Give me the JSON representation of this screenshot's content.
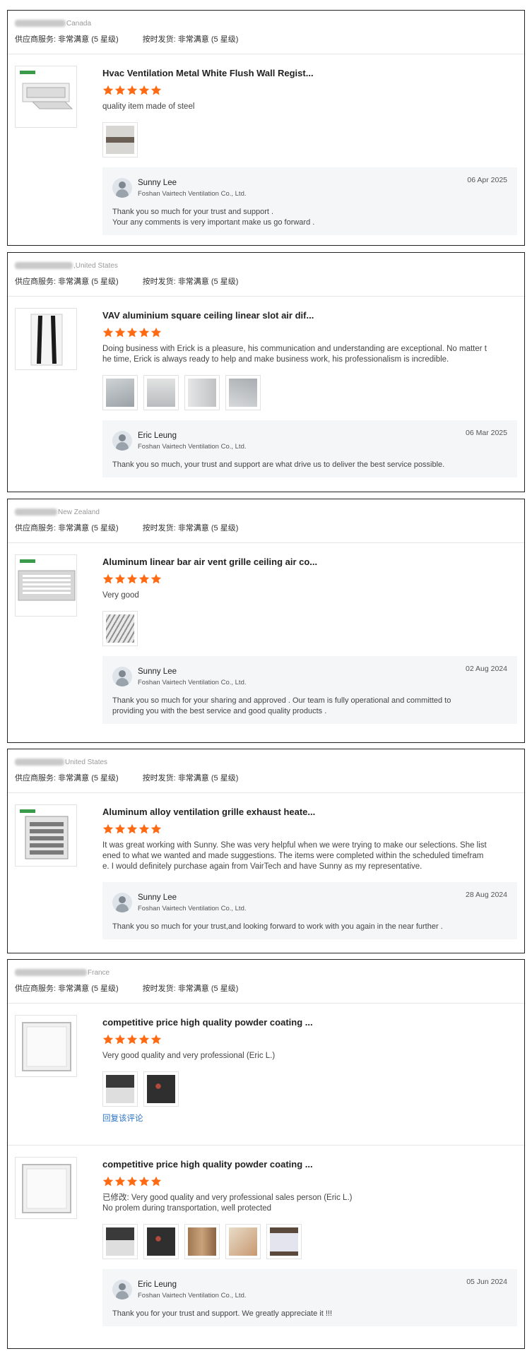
{
  "star_color": "#ff6a13",
  "rating_labels": {
    "supplier_service": "供应商服务:",
    "on_time": "按时发货:",
    "value": "非常满意",
    "level": "(5 星级)"
  },
  "reviews": [
    {
      "country": "Canada",
      "products": [
        {
          "title": "Hvac Ventilation Metal White Flush Wall Regist...",
          "stars": 5,
          "text": "quality item made of steel",
          "photo_count": 1
        }
      ],
      "reply": {
        "name": "Sunny Lee",
        "company": "Foshan Vairtech Ventilation Co., Ltd.",
        "date": "06 Apr 2025",
        "text_line1": "Thank you so much for your trust and support .",
        "text_line2": "Your any comments is very important make us go forward ."
      }
    },
    {
      "country": ",United States",
      "products": [
        {
          "title": "VAV aluminium square ceiling linear slot air dif...",
          "stars": 5,
          "text_line1": "Doing business with Erick is a pleasure, his communication and understanding are exceptional. No matter t",
          "text_line2": "he time, Erick is always ready to help and make business work, his professionalism is incredible.",
          "photo_count": 4
        }
      ],
      "reply": {
        "name": "Eric Leung",
        "company": "Foshan Vairtech Ventilation Co., Ltd.",
        "date": "06 Mar 2025",
        "text_line1": "Thank you so much, your trust and support are what drive us to deliver the best service possible."
      }
    },
    {
      "country": "New Zealand",
      "products": [
        {
          "title": "Aluminum linear bar air vent grille ceiling air co...",
          "stars": 5,
          "text": "Very good",
          "photo_count": 1
        }
      ],
      "reply": {
        "name": "Sunny Lee",
        "company": "Foshan Vairtech Ventilation Co., Ltd.",
        "date": "02 Aug 2024",
        "text_line1": "Thank you so much for your sharing and approved . Our team is fully operational and committed to",
        "text_line2": "providing you with the best service and good quality products ."
      }
    },
    {
      "country": "United States",
      "products": [
        {
          "title": "Aluminum alloy ventilation grille exhaust heate...",
          "stars": 5,
          "text_line1": "It was great working with Sunny. She was very helpful when we were trying to make our selections. She list",
          "text_line2": "ened to what we wanted and made suggestions. The items were completed within the scheduled timefram",
          "text_line3": "e. I would definitely purchase again from VairTech and have Sunny as my representative."
        }
      ],
      "reply": {
        "name": "Sunny Lee",
        "company": "Foshan Vairtech Ventilation Co., Ltd.",
        "date": "28 Aug 2024",
        "text_line1": "Thank you so much for your trust,and looking forward to work with you again in the near further ."
      }
    },
    {
      "country": "France",
      "products": [
        {
          "title": "competitive price high quality powder coating ...",
          "stars": 5,
          "text": "Very good quality and very professional (Eric L.)",
          "photo_count": 2,
          "link": "回复该评论"
        },
        {
          "title": "competitive price high quality powder coating ...",
          "stars": 5,
          "text_line1": "已修改: Very good quality and very professional sales person (Eric L.)",
          "text_line2": "No prolem during transportation, well protected",
          "photo_count": 5
        }
      ],
      "reply": {
        "name": "Eric Leung",
        "company": "Foshan Vairtech Ventilation Co., Ltd.",
        "date": "05 Jun 2024",
        "text_line1": "Thank you for your trust and support. We greatly appreciate it !!!"
      }
    }
  ]
}
